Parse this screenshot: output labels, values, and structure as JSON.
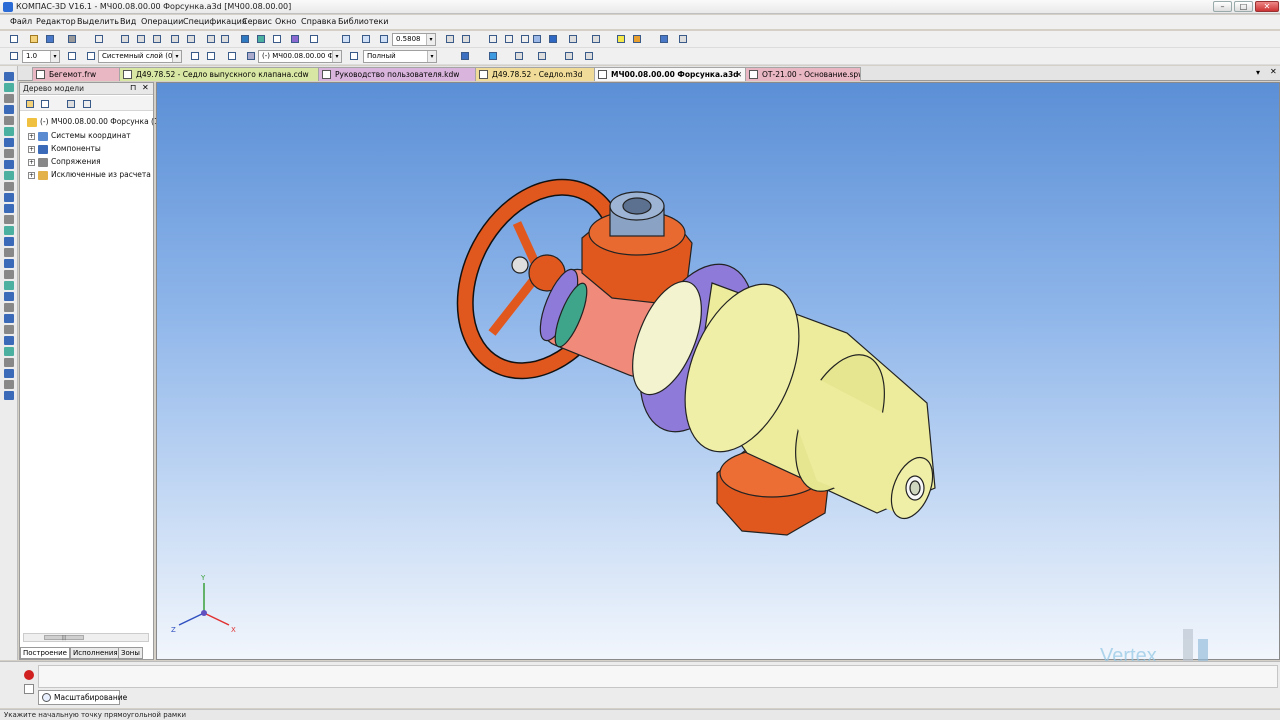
{
  "window": {
    "title": "КОМПАС-3D V16.1 - МЧ00.08.00.00 Форсунка.a3d [МЧ00.08.00.00]",
    "minimize": "–",
    "maximize": "□",
    "close": "✕"
  },
  "menu": [
    "Файл",
    "Редактор",
    "Выделить",
    "Вид",
    "Операции",
    "Спецификация",
    "Сервис",
    "Окно",
    "Справка",
    "Библиотеки"
  ],
  "toolbar": {
    "zoom_value": "0.5808",
    "line_scale": "1.0",
    "layer": "Системный слой (0)",
    "assembly_combo": "(-) МЧ00.08.00.00 Ф",
    "display_mode": "Полный"
  },
  "tabs": [
    {
      "label": "Бегемот.frw",
      "color": "#e9b7c4"
    },
    {
      "label": "Д49.78.52 - Седло выпускного клапана.cdw",
      "color": "#d9e7a4"
    },
    {
      "label": "Руководство пользователя.kdw",
      "color": "#d9b4dc"
    },
    {
      "label": "Д49.78.52 - Седло.m3d",
      "color": "#f0dc98"
    },
    {
      "label": "МЧ00.08.00.00 Форсунка.a3d",
      "color": "#f7f7f7",
      "close": "✕"
    },
    {
      "label": "ОТ-21.00 - Основание.spw",
      "color": "#e9b7c4"
    }
  ],
  "tree": {
    "header": "Дерево модели",
    "pin": "⊓",
    "close": "✕",
    "root": "(-) МЧ00.08.00.00 Форсунка (1",
    "items": [
      "Системы координат",
      "Компоненты",
      "Сопряжения",
      "Исключенные из расчета"
    ],
    "tabs": [
      "Построение",
      "Исполнения",
      "Зоны"
    ],
    "scroll_grip": "|||"
  },
  "axes": {
    "x": "X",
    "y": "Y",
    "z": "Z"
  },
  "bottom": {
    "tab": "Масштабирование",
    "status": "Укажите начальную точку прямоугольной рамки"
  },
  "watermark": "Vertex",
  "colors": {
    "orange": "#e1581f",
    "yellow": "#ecec9c",
    "violet": "#8e7ad8",
    "salmon": "#f08a7a",
    "teal": "#3fa58a",
    "steel": "#8aa2c4"
  }
}
